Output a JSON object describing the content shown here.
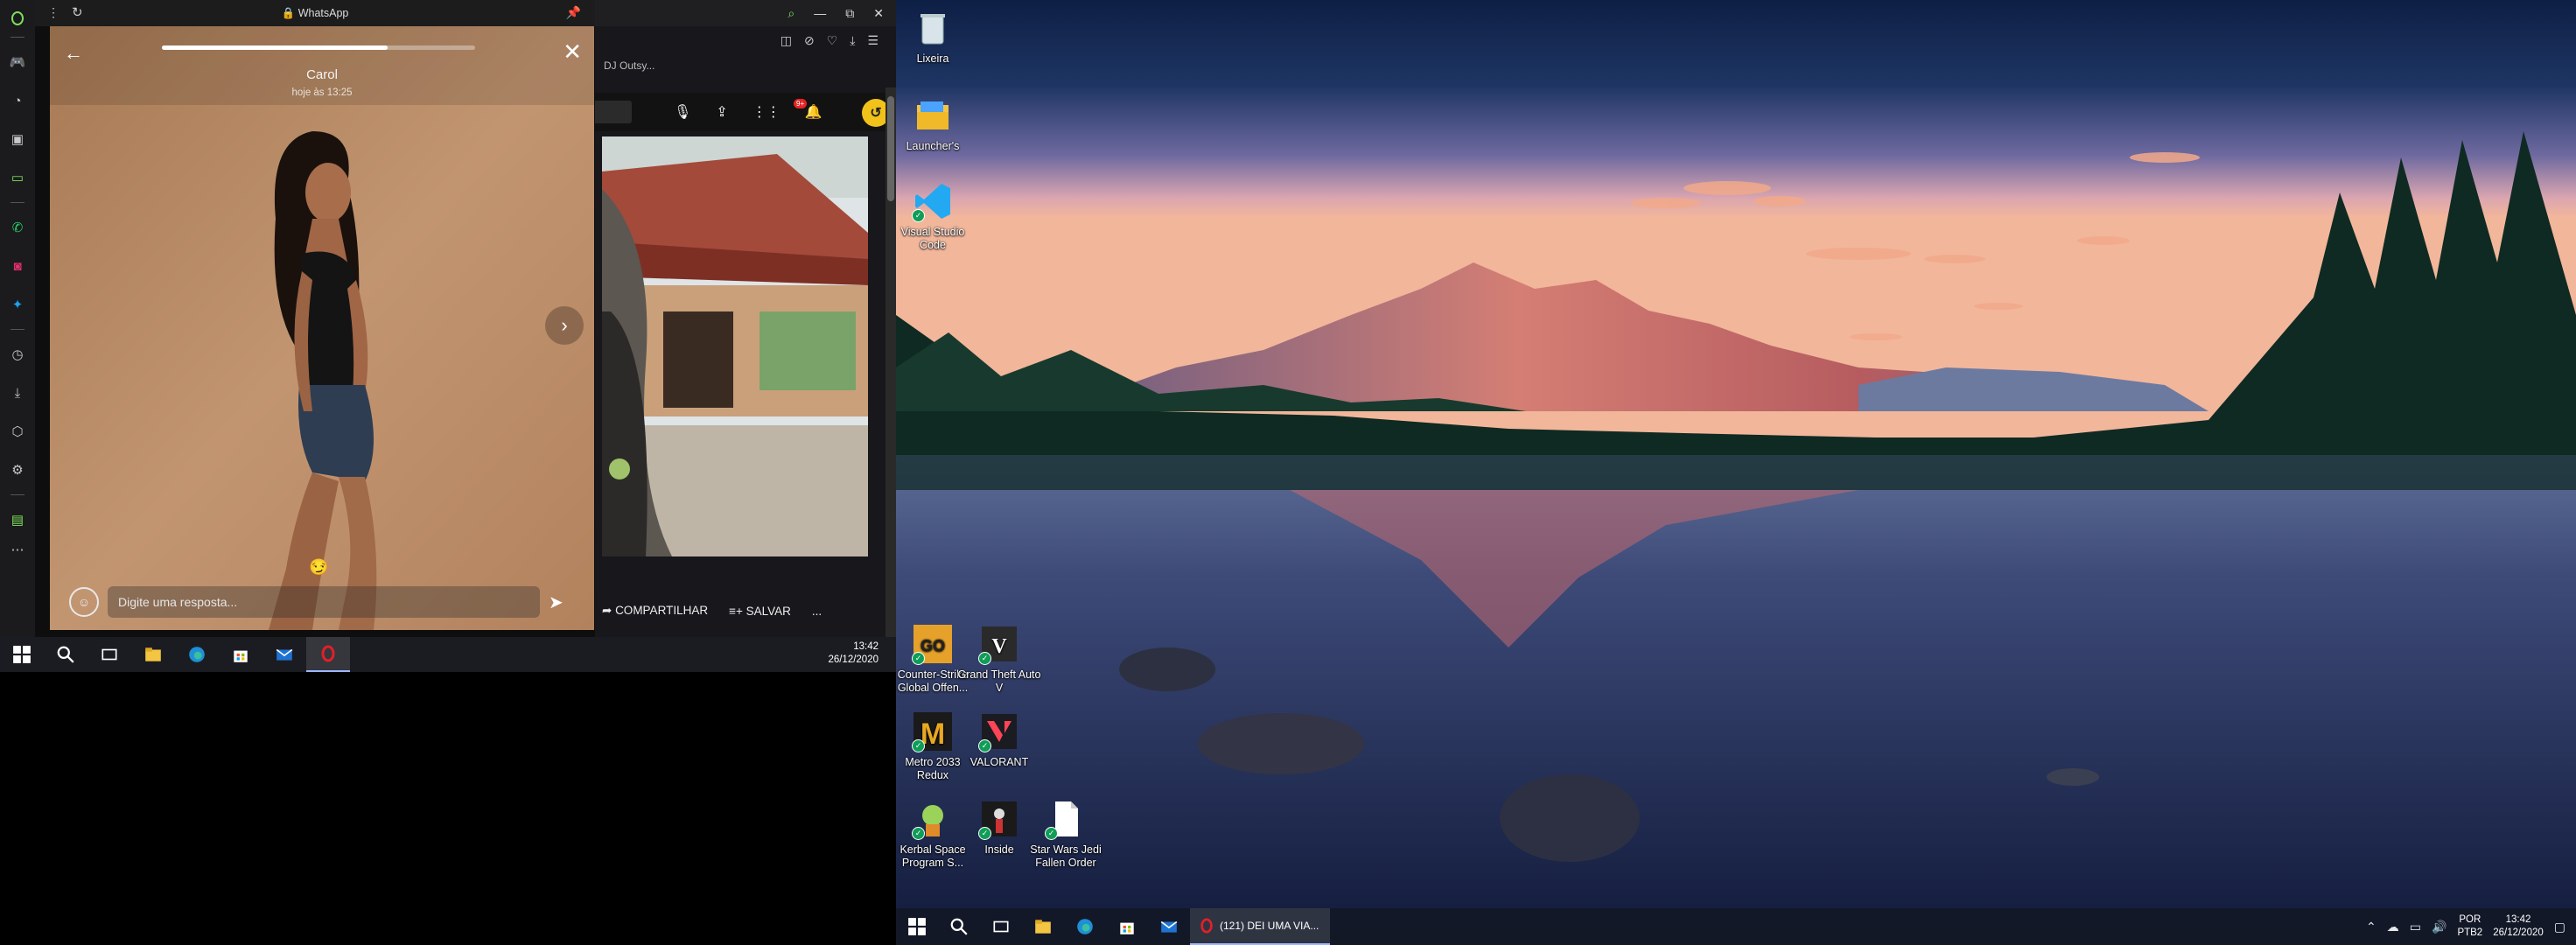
{
  "whatsapp": {
    "window_title": "WhatsApp",
    "story": {
      "contact_name": "Carol",
      "posted_time": "hoje às 13:25",
      "progress": 0.72,
      "reply_placeholder": "Digite uma resposta...",
      "caption_emoji": "😏"
    }
  },
  "background_page": {
    "tab_fragment": "DJ Outsy...",
    "notification_count": "9+",
    "actions": {
      "share": "COMPARTILHAR",
      "save": "SALVAR",
      "more": "..."
    }
  },
  "taskbar_left": {
    "time": "13:42",
    "date": "26/12/2020"
  },
  "desktop_icons": [
    {
      "label": "Lixeira",
      "icon": "recycle-bin-icon"
    },
    {
      "label": "Launcher's",
      "icon": "folder-icon"
    },
    {
      "label": "Visual Studio Code",
      "icon": "vscode-icon"
    },
    {
      "label": "Counter-Strike Global Offen...",
      "icon": "csgo-icon"
    },
    {
      "label": "Grand Theft Auto V",
      "icon": "gta-icon"
    },
    {
      "label": "Metro 2033 Redux",
      "icon": "metro-icon"
    },
    {
      "label": "VALORANT",
      "icon": "valorant-icon"
    },
    {
      "label": "Kerbal Space Program S...",
      "icon": "kerbal-icon"
    },
    {
      "label": "Inside",
      "icon": "inside-icon"
    },
    {
      "label": "Star Wars Jedi Fallen Order",
      "icon": "document-icon"
    }
  ],
  "taskbar_right": {
    "opera_window_title": "(121) DEI UMA VIA...",
    "language_line1": "POR",
    "language_line2": "PTB2",
    "time": "13:42",
    "date": "26/12/2020"
  },
  "colors": {
    "accent_opera": "#e0202a",
    "whatsapp_green": "#25d366"
  }
}
